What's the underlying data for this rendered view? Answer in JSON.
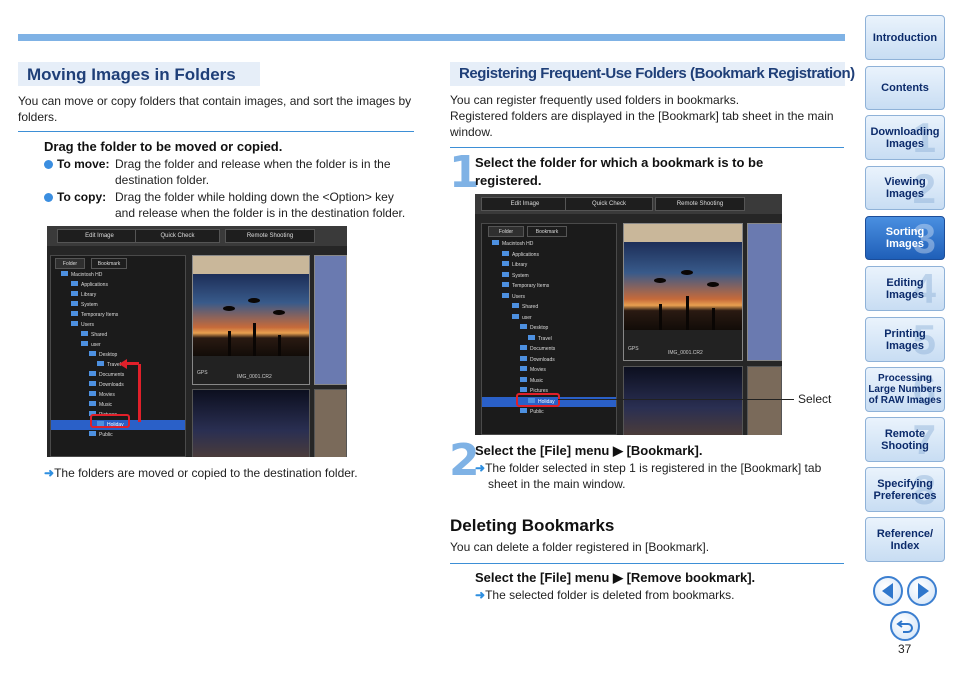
{
  "left": {
    "heading": "Moving Images in Folders",
    "intro": "You can move or copy folders that contain images, and sort the images by folders.",
    "step_title": "Drag the folder to be moved or copied.",
    "bullets": [
      {
        "label": "To move:",
        "text1": "Drag the folder and release when the folder is in the",
        "text2": "destination folder."
      },
      {
        "label": "To copy:",
        "text1": "Drag the folder while holding down the <Option> key",
        "text2": "and release when the folder is in the destination folder."
      }
    ],
    "result": "The folders are moved or copied to the destination folder."
  },
  "right": {
    "heading": "Registering Frequent-Use Folders (Bookmark Registration)",
    "intro1": "You can register frequently used folders in bookmarks.",
    "intro2": "Registered folders are displayed in the [Bookmark] tab sheet in the main window.",
    "step1_num": "1",
    "step1_title1": "Select the folder for which a bookmark is to be",
    "step1_title2": "registered.",
    "callout": "Select",
    "step2_num": "2",
    "step2_title": "Select the [File] menu ▶ [Bookmark].",
    "step2_result1": "The folder selected in step 1 is registered in the [Bookmark] tab",
    "step2_result2": "sheet in the main window.",
    "del_heading": "Deleting Bookmarks",
    "del_intro": "You can delete a folder registered in [Bookmark].",
    "del_step": "Select the [File] menu ▶ [Remove bookmark].",
    "del_result": "The selected folder is deleted from bookmarks."
  },
  "screens": {
    "tabs": [
      "Edit Image",
      "Quick Check",
      "Remote Shooting"
    ],
    "panel_tabs": [
      "Folder",
      "Bookmark"
    ],
    "tree": [
      "Macintosh HD",
      "Applications",
      "Library",
      "System",
      "Temporary Items",
      "Users",
      "Shared",
      "user",
      "Desktop",
      "Travel",
      "Documents",
      "Downloads",
      "Movies",
      "Music",
      "Pictures",
      "Holiday",
      "Public"
    ],
    "filename": "IMG_0001.CR2",
    "badge": "GPS"
  },
  "nav": [
    {
      "label": "Introduction",
      "digit": ""
    },
    {
      "label": "Contents",
      "digit": ""
    },
    {
      "label": "Downloading Images",
      "digit": "1"
    },
    {
      "label": "Viewing Images",
      "digit": "2"
    },
    {
      "label": "Sorting Images",
      "digit": "3"
    },
    {
      "label": "Editing Images",
      "digit": "4"
    },
    {
      "label": "Printing Images",
      "digit": "5"
    },
    {
      "label": "Processing Large Numbers of RAW Images",
      "digit": "6"
    },
    {
      "label": "Remote Shooting",
      "digit": "7"
    },
    {
      "label": "Specifying Preferences",
      "digit": "8"
    },
    {
      "label": "Reference/ Index",
      "digit": ""
    }
  ],
  "page_number": "37",
  "colors": {
    "accent": "#7fb2e5",
    "heading": "#1f3f78",
    "active_nav": "#1f5fb8",
    "highlight": "#e0202a"
  }
}
